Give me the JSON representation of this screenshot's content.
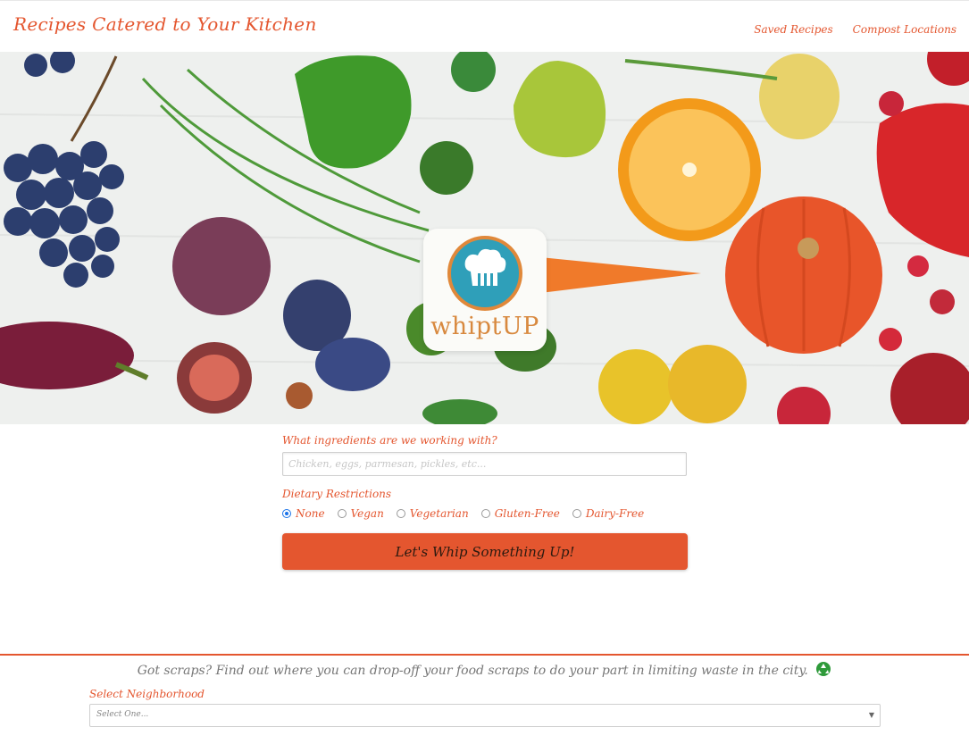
{
  "header": {
    "brand": "Recipes Catered to Your Kitchen",
    "nav": [
      "Saved Recipes",
      "Compost Locations"
    ]
  },
  "hero": {
    "logo_text": "whiptUP"
  },
  "form": {
    "ingredients_label": "What ingredients are we working with?",
    "ingredients_placeholder": "Chicken, eggs, parmesan, pickles, etc...",
    "ingredients_value": "",
    "dietary_label": "Dietary Restrictions",
    "dietary_options": [
      "None",
      "Vegan",
      "Vegetarian",
      "Gluten-Free",
      "Dairy-Free"
    ],
    "dietary_selected": "None",
    "submit_label": "Let's Whip Something Up!"
  },
  "compost": {
    "message": "Got scraps? Find out where you can drop-off your food scraps to do your part in limiting waste in the city.",
    "neighborhood_label": "Select Neighborhood",
    "neighborhood_value": "Select One..."
  },
  "colors": {
    "accent": "#e4562f",
    "logo_blue": "#2f9fb9",
    "logo_orange": "#e0883a",
    "radio_selected": "#1a73e8"
  },
  "icons": [
    "chef-hat-utensils-logo-icon",
    "recycle-icon",
    "chevron-down-icon"
  ]
}
